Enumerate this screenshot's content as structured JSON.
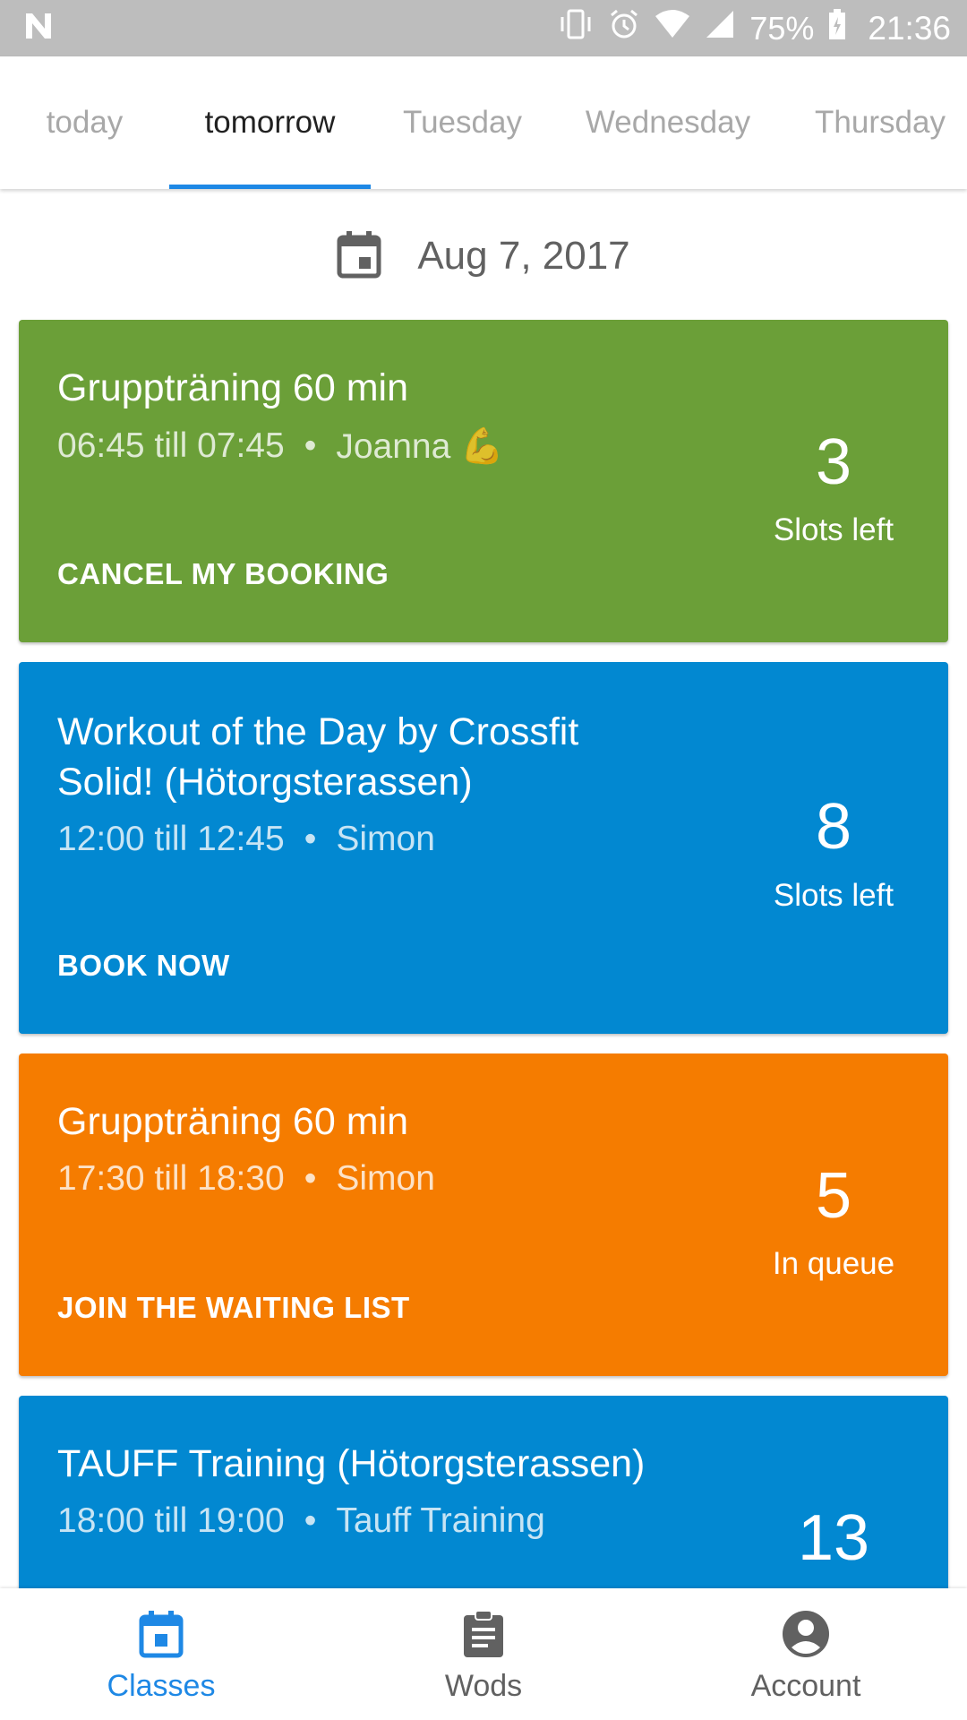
{
  "status_bar": {
    "battery": "75%",
    "time": "21:36"
  },
  "tabs": [
    {
      "label": "today"
    },
    {
      "label": "tomorrow"
    },
    {
      "label": "Tuesday"
    },
    {
      "label": "Wednesday"
    },
    {
      "label": "Thursday"
    }
  ],
  "date": "Aug 7, 2017",
  "cards": [
    {
      "title": "Gruppträning 60 min",
      "time": "06:45 till 07:45",
      "separator": "•",
      "instructor": "Joanna 💪",
      "count": "3",
      "count_label": "Slots left",
      "action": "CANCEL MY BOOKING",
      "color": "#6b9f38"
    },
    {
      "title": "Workout of the Day by Crossfit Solid! (Hötorgsterassen)",
      "time": "12:00 till 12:45",
      "separator": "•",
      "instructor": "Simon",
      "count": "8",
      "count_label": "Slots left",
      "action": "BOOK NOW",
      "color": "#0288d1"
    },
    {
      "title": "Gruppträning 60 min",
      "time": "17:30 till 18:30",
      "separator": "•",
      "instructor": "Simon",
      "count": "5",
      "count_label": "In queue",
      "action": "JOIN THE WAITING LIST",
      "color": "#f57c00"
    },
    {
      "title": "TAUFF Training (Hötorgsterassen)",
      "time": "18:00 till 19:00",
      "separator": "•",
      "instructor": "Tauff Training",
      "count": "13",
      "color": "#0288d1"
    }
  ],
  "bottom_nav": [
    {
      "label": "Classes",
      "icon": "calendar-icon"
    },
    {
      "label": "Wods",
      "icon": "clipboard-icon"
    },
    {
      "label": "Account",
      "icon": "account-circle-icon"
    }
  ],
  "colors": {
    "accent": "#1e88e5",
    "status_bar": "#bdbdbd"
  }
}
